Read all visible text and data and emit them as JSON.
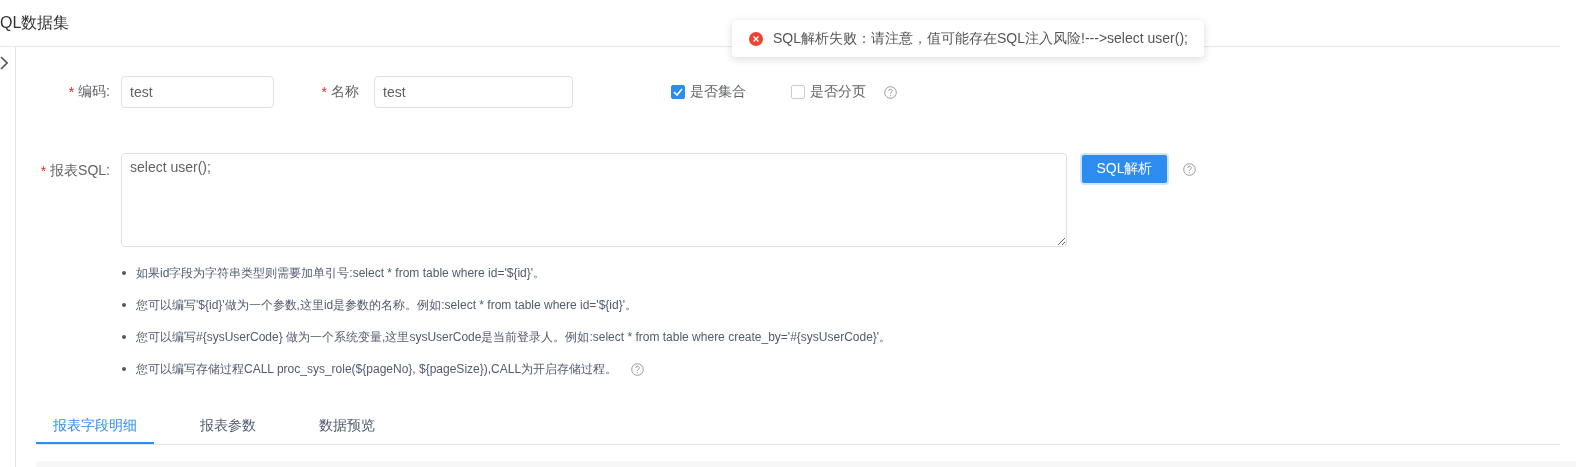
{
  "header": {
    "title": "QL数据集"
  },
  "toast": {
    "kind": "error",
    "message": "SQL解析失败：请注意，值可能存在SQL注入风险!--->select user();"
  },
  "form": {
    "code": {
      "label": "编码:",
      "required_mark": "*",
      "value": "test"
    },
    "name": {
      "label": "名称",
      "required_mark": "*",
      "value": "test"
    },
    "options": [
      {
        "label": "是否集合",
        "checked": true,
        "help": false
      },
      {
        "label": "是否分页",
        "checked": false,
        "help": true
      }
    ],
    "sql": {
      "label": "报表SQL:",
      "required_mark": "*",
      "value": "select user();"
    },
    "parse_button": "SQL解析",
    "hints": [
      {
        "text": "如果id字段为字符串类型则需要加单引号:select * from table where id='${id}'。",
        "help": false
      },
      {
        "text": "您可以编写'${id}'做为一个参数,这里id是参数的名称。例如:select * from table where id='${id}'。",
        "help": false
      },
      {
        "text": "您可以编写#{sysUserCode} 做为一个系统变量,这里sysUserCode是当前登录人。例如:select * from table where create_by='#{sysUserCode}'。",
        "help": false
      },
      {
        "text": "您可以编写存储过程CALL proc_sys_role(${pageNo}, ${pageSize}),CALL为开启存储过程。",
        "help": true
      }
    ]
  },
  "tabs": [
    {
      "label": "报表字段明细",
      "selected": true
    },
    {
      "label": "报表参数",
      "selected": false
    },
    {
      "label": "数据预览",
      "selected": false
    }
  ]
}
